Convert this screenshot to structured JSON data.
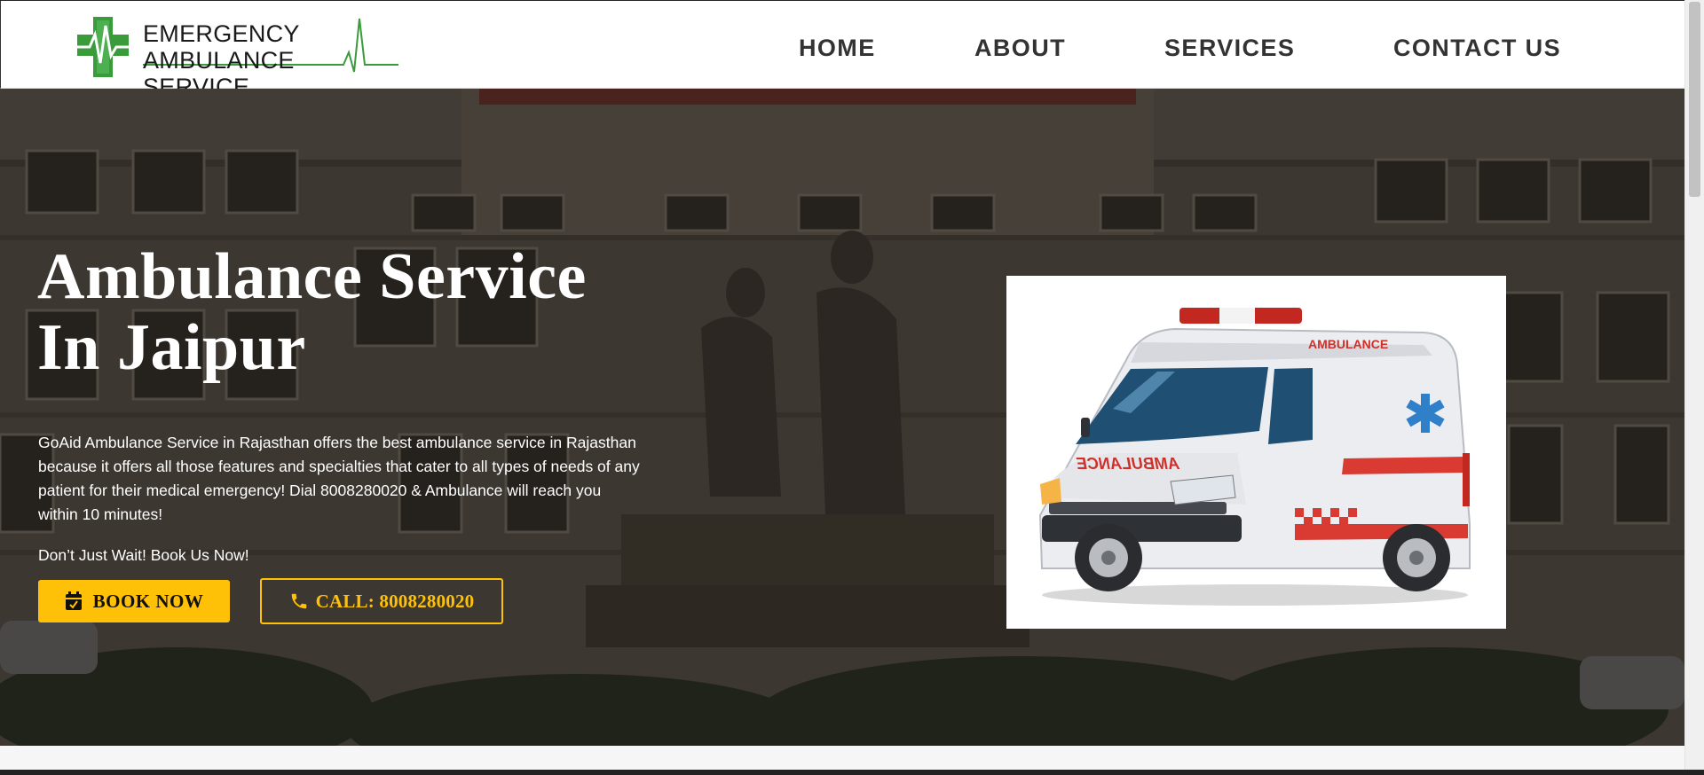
{
  "logo": {
    "line1": "EMERGENCY",
    "line2": "AMBULANCE SERVICE",
    "brand_color": "#3a9b3a"
  },
  "nav": {
    "items": [
      {
        "label": "HOME"
      },
      {
        "label": "ABOUT"
      },
      {
        "label": "SERVICES"
      },
      {
        "label": "CONTACT US"
      }
    ]
  },
  "hero": {
    "title_line1": "Ambulance Service",
    "title_line2": "In Jaipur",
    "description": "GoAid Ambulance Service in Rajasthan offers the best ambulance service in Rajasthan because it offers all those features and specialties that cater to all types of needs of any patient for their medical emergency! Dial 8008280020 & Ambulance will reach you within 10 minutes!",
    "cta_text": "Don’t Just Wait! Book Us Now!",
    "book_button": "BOOK NOW",
    "call_button": "CALL: 8008280020",
    "accent_color": "#ffc107",
    "image_texts": {
      "ambulance_side": "AMBULANCE",
      "ambulance_front": "AMBULANCE"
    }
  },
  "icons": {
    "book": "calendar-icon",
    "call": "phone-icon"
  }
}
